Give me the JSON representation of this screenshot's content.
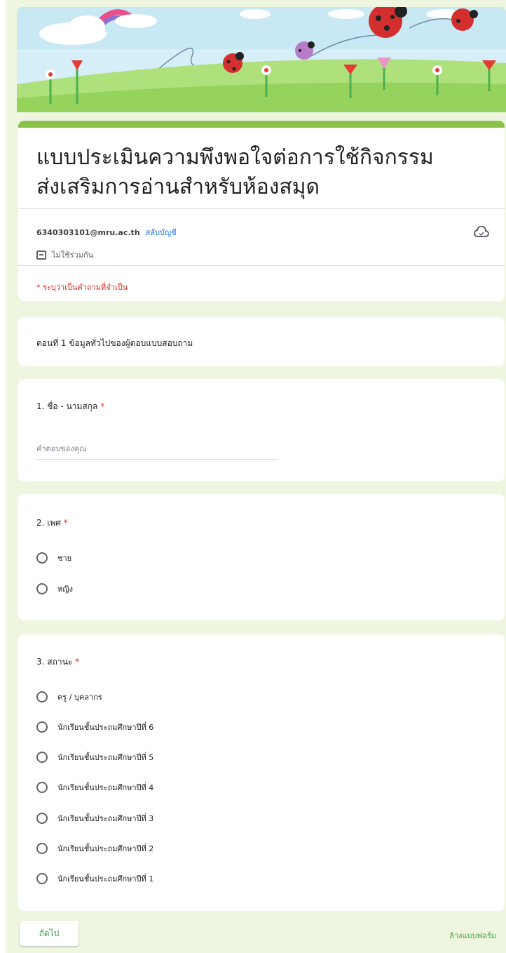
{
  "form": {
    "title": "แบบประเมินความพึงพอใจต่อการใช้กิจกรรมส่งเสริมการอ่านสำหรับห้องสมุด",
    "title_line1": "แบบประเมินความพึงพอใจต่อการใช้กิจกรรม",
    "title_line2": "ส่งเสริมการอ่านสำหรับห้องสมุด",
    "account_email": "6340303101@mru.ac.th",
    "switch_account": "สลับบัญชี",
    "not_shared": "ไม่ใช้ร่วมกัน",
    "required_note": "* ระบุว่าเป็นคำถามที่จำเป็น"
  },
  "section": {
    "title": "ตอนที่ 1 ข้อมูลทั่วไปของผู้ตอบแบบสอบถาม"
  },
  "questions": [
    {
      "title": "1. ชื่อ - นามสกุล",
      "required_mark": "*",
      "placeholder": "คำตอบของคุณ"
    },
    {
      "title": "2. เพศ",
      "required_mark": "*",
      "options": [
        "ชาย",
        "หญิง"
      ]
    },
    {
      "title": "3. สถานะ",
      "required_mark": "*",
      "options": [
        "ครู / บุคลากร",
        "นักเรียนชั้นประถมศึกษาปีที่ 6",
        "นักเรียนชั้นประถมศึกษาปีที่ 5",
        "นักเรียนชั้นประถมศึกษาปีที่ 4",
        "นักเรียนชั้นประถมศึกษาปีที่ 3",
        "นักเรียนชั้นประถมศึกษาปีที่ 2",
        "นักเรียนชั้นประถมศึกษาปีที่ 1"
      ]
    }
  ],
  "footer": {
    "next_label": "ถัดไป",
    "clear_label": "ล้างแบบฟอร์ม"
  },
  "colors": {
    "theme_green": "#8bc34a",
    "background": "#eef6df",
    "required_red": "#d93025",
    "link_blue": "#1a73e8"
  }
}
